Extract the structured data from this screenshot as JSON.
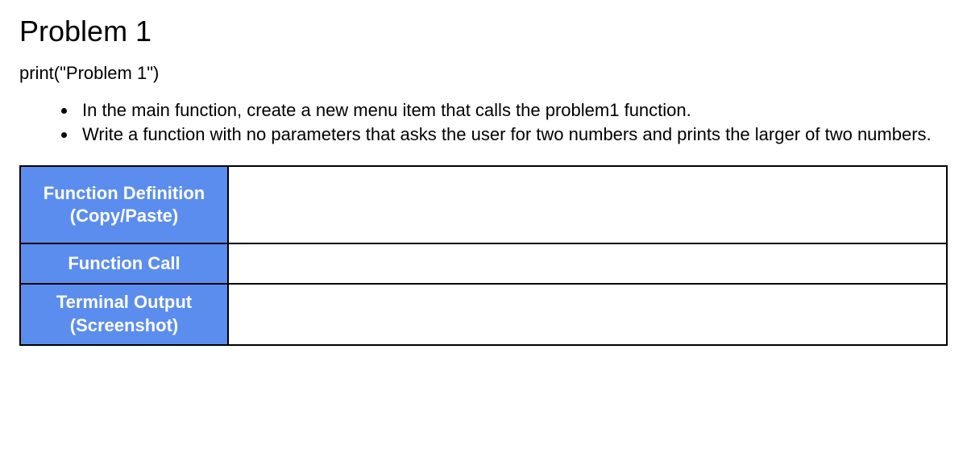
{
  "heading": "Problem 1",
  "code_line": "print(\"Problem 1\")",
  "bullets": [
    "In the main function, create a new menu item that calls the problem1 function.",
    "Write a function with no parameters that asks the user for two numbers and prints the larger of two numbers."
  ],
  "table": {
    "rows": [
      {
        "label": "Function Definition (Copy/Paste)",
        "value": ""
      },
      {
        "label": "Function Call",
        "value": ""
      },
      {
        "label": "Terminal Output (Screenshot)",
        "value": ""
      }
    ]
  }
}
